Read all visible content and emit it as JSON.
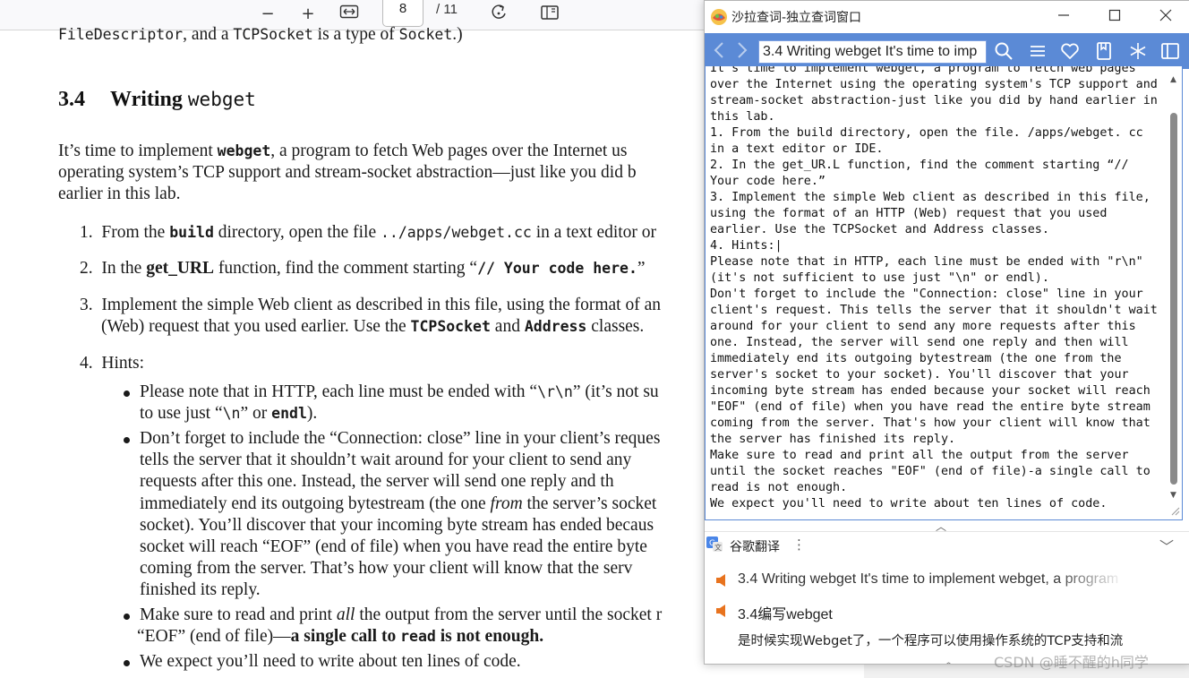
{
  "pdf": {
    "toolbar": {
      "zoom_out": "−",
      "zoom_in": "+",
      "page_number": "8",
      "page_total": "/ 11"
    },
    "top_line": {
      "mono1": "FileDescriptor",
      "t1": ", and a ",
      "mono2": "TCPSocket",
      "t2": " is a type of ",
      "mono3": "Socket",
      "t3": ".)"
    },
    "heading": {
      "number": "3.4",
      "text": "Writing ",
      "mono": "webget"
    },
    "intro": {
      "l1a": "It’s time to implement ",
      "l1m": "webget",
      "l1b": ", a program to fetch Web pages over the Internet us",
      "l2": "operating system’s TCP support and stream-socket abstraction—just like you did b",
      "l3": "earlier in this lab."
    },
    "item1": {
      "n": "1.",
      "a": "From the ",
      "m1": "build",
      "b": " directory, open the file ",
      "m2": "../apps/webget.cc",
      "c": " in a text editor or"
    },
    "item2": {
      "n": "2.",
      "a": "In the ",
      "m1": "get_URL",
      "b": " function, find the comment starting “",
      "m2": "// Your code here.",
      "c": "”"
    },
    "item3": {
      "n": "3.",
      "a": "Implement the simple Web client as described in this file, using the format of an",
      "b": "(Web) request that you used earlier. Use the ",
      "m1": "TCPSocket",
      "c": " and ",
      "m2": "Address",
      "d": " classes."
    },
    "item4": {
      "n": "4.",
      "a": "Hints:"
    },
    "hint1": {
      "a": "Please note that in HTTP, each line must be ended with “",
      "m1": "\\r\\n",
      "b": "” (it’s not su",
      "c": "to use just “",
      "m2": "\\n",
      "d": "” or ",
      "m3": "endl",
      "e": ")."
    },
    "hint2": {
      "l1": "Don’t forget to include the “Connection: close” line in your client’s reques",
      "l2": "tells the server that it shouldn’t wait around for your client to send any",
      "l3": "requests after this one.  Instead, the server will send one reply and th",
      "l4a": "immediately end its outgoing bytestream (the one ",
      "l4i": "from",
      "l4b": " the server’s socket",
      "l5": "socket). You’ll discover that your incoming byte stream has ended becaus",
      "l6": "socket will reach “EOF” (end of file) when you have read the entire byte",
      "l7": "coming from the server.  That’s how your client will know that the serv",
      "l8": "finished its reply."
    },
    "hint3": {
      "a": "Make sure to read and print ",
      "i": "all",
      "b": " the output from the server until the socket r",
      "c": "“EOF” (end of file)—",
      "bold1": "a single call to ",
      "m": "read",
      "bold2": " is not enough."
    },
    "hint4": {
      "a": "We expect you’ll need to write about ten lines of code."
    }
  },
  "dict": {
    "title": "沙拉查词-独立查词窗口",
    "search_value": "3.4 Writing webget It's time to imp",
    "text": "It's time to implement webget, a program to fetch web pages\nover the Internet using the operating system's TCP support and\nstream-socket abstraction-just like you did by hand earlier in\nthis lab.\n1. From the build directory, open the file. /apps/webget. cc\nin a text editor or IDE.\n2. In the get_UR.L function, find the comment starting “//\nYour code here.”\n3. Implement the simple Web client as described in this file,\nusing the format of an HTTP (Web) request that you used\nearlier. Use the TCPSocket and Address classes.\n4. Hints:|\nPlease note that in HTTP, each line must be ended with \"r\\n\"\n(it's not sufficient to use just \"\\n\" or endl).\nDon't forget to include the \"Connection: close\" line in your\nclient's request. This tells the server that it shouldn't wait\naround for your client to send any more requests after this\none. Instead, the server will send one reply and then will\nimmediately end its outgoing bytestream (the one from the\nserver's socket to your socket). You'll discover that your\nincoming byte stream has ended because your socket will reach\n\"EOF\" (end of file) when you have read the entire byte stream\ncoming from the server. That's how your client will know that\nthe server has finished its reply.\nMake sure to read and print all the output from the server\nuntil the socket reaches \"EOF\" (end of file)-a single call to\nread is not enough.\nWe expect you'll need to write about ten lines of code.",
    "engine_name": "谷歌翻译",
    "translation_line1": "3.4 Writing webget It's time to implement webget, a program",
    "translation_line2": "3.4编写webget",
    "translation_line3": "是时候实现Webget了，一个程序可以使用操作系统的TCP支持和流"
  },
  "watermark": "CSDN @睡不醒的h同学",
  "colors": {
    "search_bar": "#5b8ad6",
    "speaker": "#e8731e"
  }
}
